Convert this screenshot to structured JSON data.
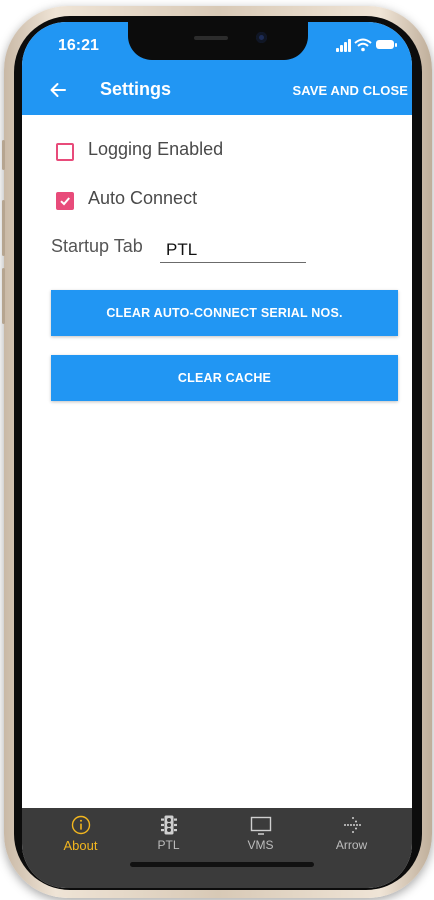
{
  "status_bar": {
    "time": "16:21"
  },
  "app_bar": {
    "title": "Settings",
    "save_label": "SAVE AND CLOSE"
  },
  "settings": {
    "logging": {
      "label": "Logging Enabled",
      "checked": false
    },
    "auto_connect": {
      "label": "Auto Connect",
      "checked": true
    },
    "startup_tab": {
      "label": "Startup Tab",
      "value": "PTL"
    }
  },
  "buttons": {
    "clear_serials": "CLEAR AUTO-CONNECT SERIAL NOS.",
    "clear_cache": "CLEAR CACHE"
  },
  "nav": {
    "items": [
      {
        "label": "About",
        "icon": "info-icon",
        "active": true
      },
      {
        "label": "PTL",
        "icon": "traffic-light-icon",
        "active": false
      },
      {
        "label": "VMS",
        "icon": "monitor-icon",
        "active": false
      },
      {
        "label": "Arrow",
        "icon": "arrow-dots-icon",
        "active": false
      }
    ]
  },
  "colors": {
    "primary": "#2196f3",
    "checkbox": "#e84b7a",
    "nav_background": "#3b3b3b",
    "nav_active": "#f2b61f"
  }
}
